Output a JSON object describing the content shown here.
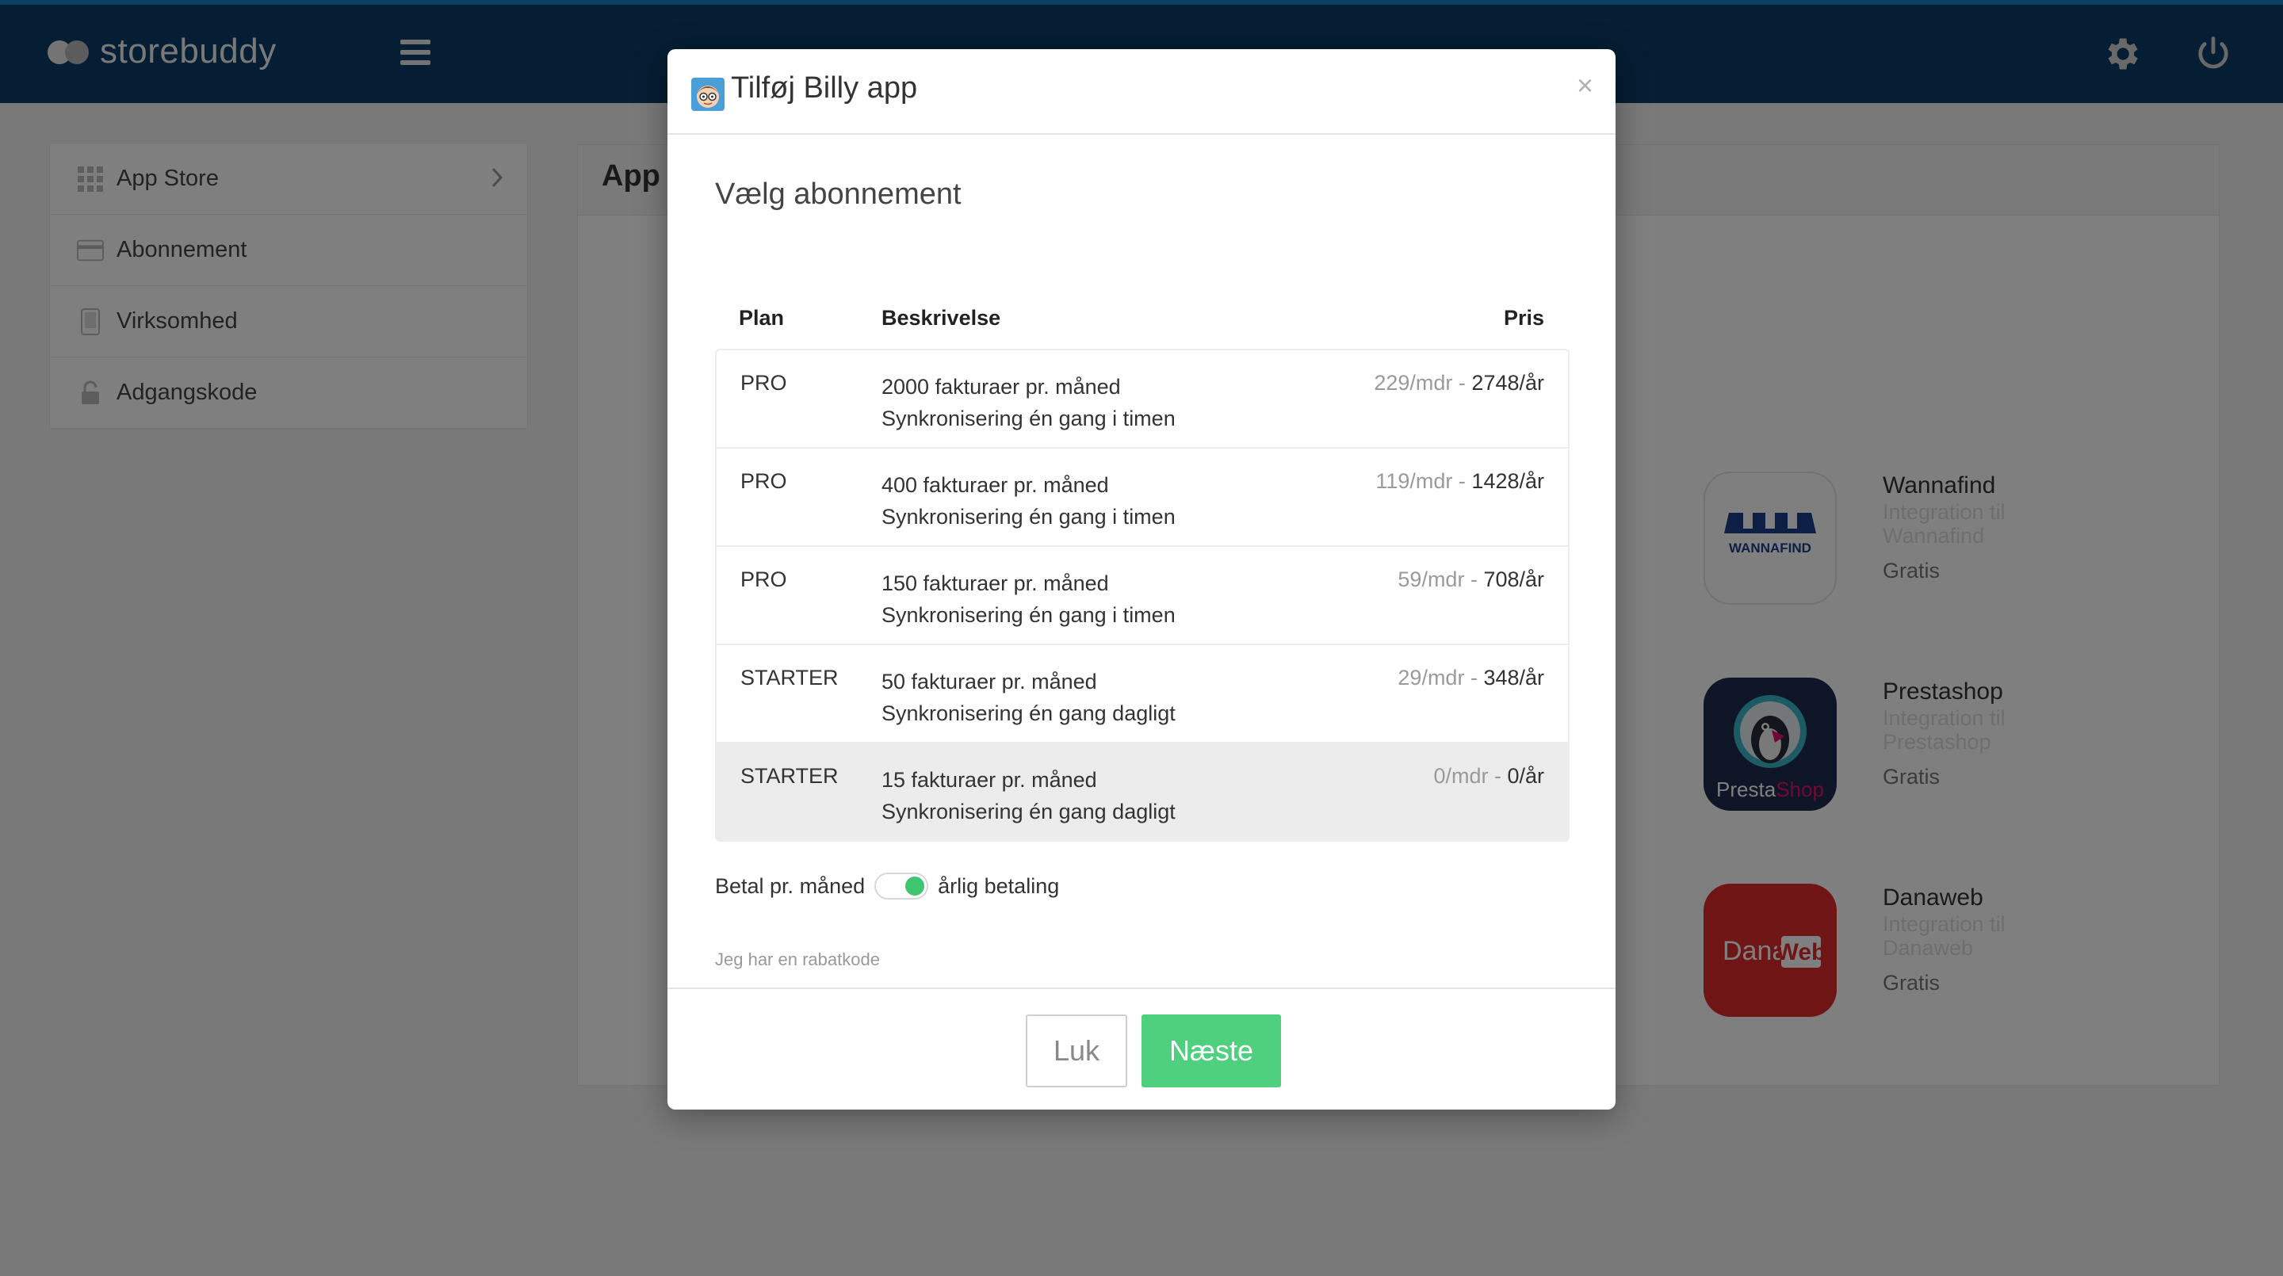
{
  "app": {
    "logo_text": "storebuddy",
    "content_title": "App S"
  },
  "sidebar": {
    "items": [
      {
        "label": "App Store",
        "icon": "grid-icon"
      },
      {
        "label": "Abonnement",
        "icon": "credit-card-icon"
      },
      {
        "label": "Virksomhed",
        "icon": "phone-icon"
      },
      {
        "label": "Adgangskode",
        "icon": "lock-icon"
      }
    ]
  },
  "apps": [
    {
      "name": "Wannafind",
      "desc": "Integration til Wannafind",
      "price": "Gratis",
      "logo_text": "WANNAFIND"
    },
    {
      "name": "Prestashop",
      "desc": "Integration til Prestashop",
      "price": "Gratis",
      "logo_text_a": "Presta",
      "logo_text_b": "Shop"
    },
    {
      "name": "Danaweb",
      "desc": "Integration til Danaweb",
      "price": "Gratis",
      "logo_text_a": "Dana",
      "logo_text_b": "Web"
    }
  ],
  "modal": {
    "title": "Tilføj Billy app",
    "close": "×",
    "section_title": "Vælg abonnement",
    "headers": {
      "plan": "Plan",
      "description": "Beskrivelse",
      "price": "Pris"
    },
    "rows": [
      {
        "plan": "PRO",
        "desc1": "2000 fakturaer pr. måned",
        "desc2": "Synkronisering én gang i timen",
        "monthly": "229/mdr - ",
        "yearly": "2748/år",
        "selected": false
      },
      {
        "plan": "PRO",
        "desc1": "400 fakturaer pr. måned",
        "desc2": "Synkronisering én gang i timen",
        "monthly": "119/mdr - ",
        "yearly": "1428/år",
        "selected": false
      },
      {
        "plan": "PRO",
        "desc1": "150 fakturaer pr. måned",
        "desc2": "Synkronisering én gang i timen",
        "monthly": "59/mdr - ",
        "yearly": "708/år",
        "selected": false
      },
      {
        "plan": "STARTER",
        "desc1": "50 fakturaer pr. måned",
        "desc2": "Synkronisering én gang dagligt",
        "monthly": "29/mdr - ",
        "yearly": "348/år",
        "selected": false
      },
      {
        "plan": "STARTER",
        "desc1": "15 fakturaer pr. måned",
        "desc2": "Synkronisering én gang dagligt",
        "monthly": "0/mdr - ",
        "yearly": "0/år",
        "selected": true
      }
    ],
    "toggle": {
      "left_label": "Betal pr. måned",
      "right_label": "årlig betaling",
      "on": true
    },
    "discount_link": "Jeg har en rabatkode",
    "buttons": {
      "close": "Luk",
      "next": "Næste"
    }
  },
  "colors": {
    "topbar": "#0a3d66",
    "accent_top": "#1b7fc7",
    "primary_button": "#4fd07e",
    "toggle_knob": "#3ec56f"
  }
}
